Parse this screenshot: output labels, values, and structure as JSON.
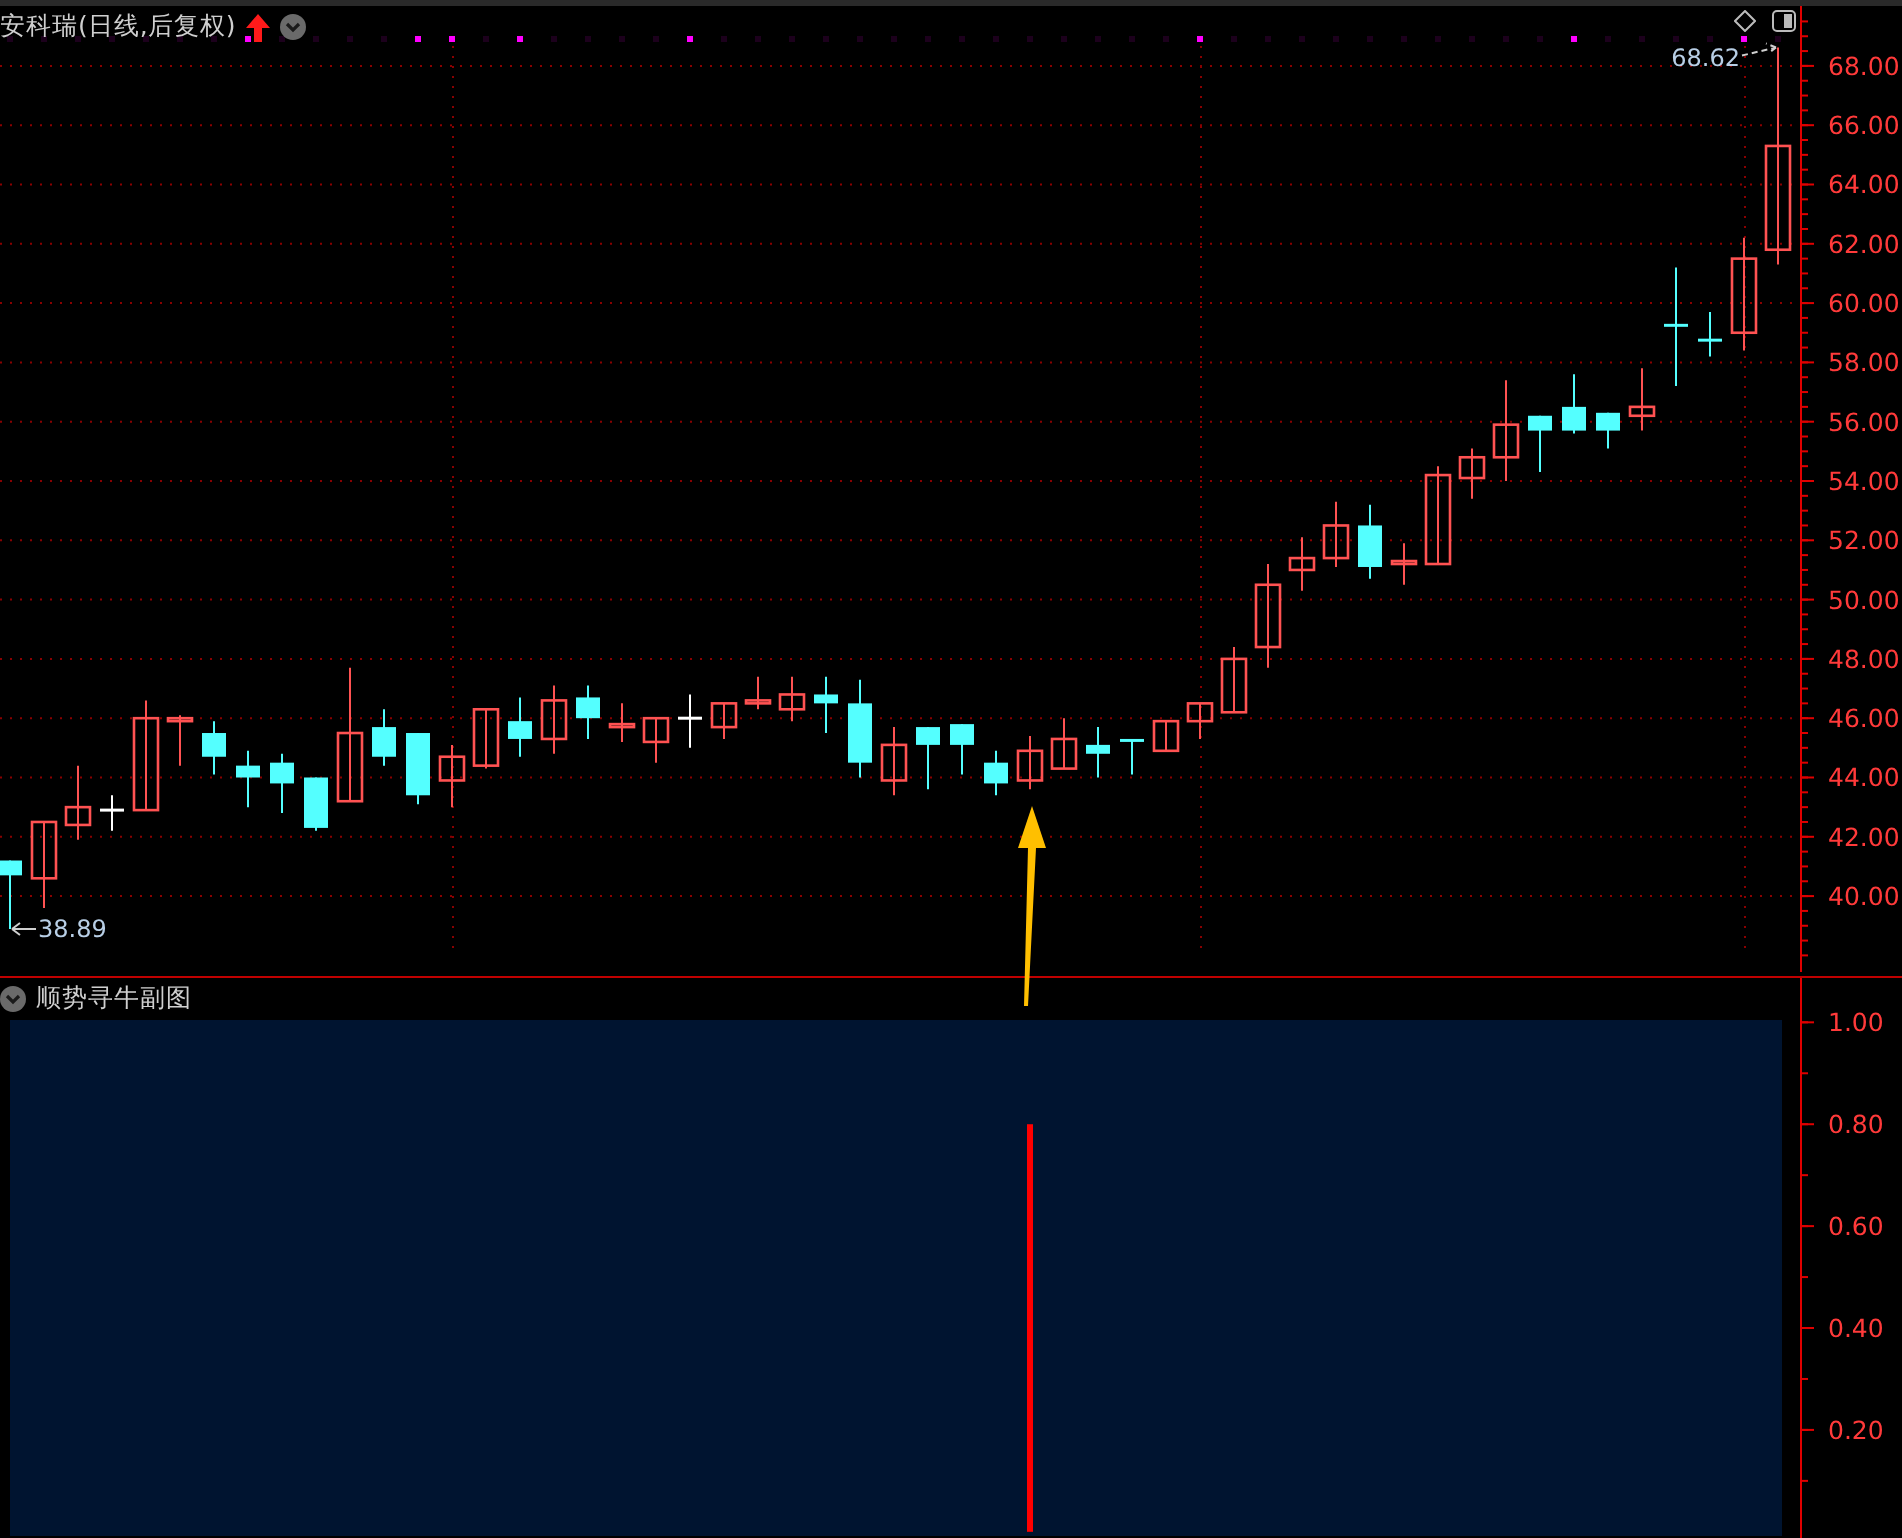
{
  "header": {
    "title": "安科瑞(日线,后复权)"
  },
  "main_chart": {
    "chart_data": {
      "type": "candlestick",
      "ylim": [
        37.44,
        70.02
      ],
      "yticks": [
        {
          "value": 40,
          "label": "40.00"
        },
        {
          "value": 42,
          "label": "42.00"
        },
        {
          "value": 44,
          "label": "44.00"
        },
        {
          "value": 46,
          "label": "46.00"
        },
        {
          "value": 48,
          "label": "48.00"
        },
        {
          "value": 50,
          "label": "50.00"
        },
        {
          "value": 52,
          "label": "52.00"
        },
        {
          "value": 54,
          "label": "54.00"
        },
        {
          "value": 56,
          "label": "56.00"
        },
        {
          "value": 58,
          "label": "58.00"
        },
        {
          "value": 60,
          "label": "60.00"
        },
        {
          "value": 62,
          "label": "62.00"
        },
        {
          "value": 64,
          "label": "64.00"
        },
        {
          "value": 66,
          "label": "66.00"
        },
        {
          "value": 68,
          "label": "68.00"
        }
      ],
      "categories": [
        null,
        null,
        null,
        null,
        null,
        null,
        null,
        null,
        null,
        null,
        null,
        null,
        null,
        null,
        null,
        null,
        null,
        null,
        null,
        null,
        null,
        null,
        null,
        null,
        null,
        null,
        null,
        null,
        null,
        null,
        null,
        null,
        null,
        null,
        null,
        null,
        null,
        null,
        null,
        null,
        null,
        null,
        null,
        null,
        null,
        null,
        null,
        null,
        null,
        null,
        null,
        null,
        null
      ],
      "ohlc": [
        [
          41.2,
          41.2,
          38.89,
          40.7
        ],
        [
          40.6,
          42.5,
          39.6,
          42.5
        ],
        [
          42.4,
          44.4,
          41.9,
          43.0
        ],
        [
          42.9,
          43.4,
          42.2,
          42.9
        ],
        [
          42.9,
          46.6,
          42.9,
          46.0
        ],
        [
          45.9,
          46.1,
          44.4,
          46.0
        ],
        [
          45.5,
          45.9,
          44.1,
          44.7
        ],
        [
          44.4,
          44.9,
          43.0,
          44.0
        ],
        [
          44.5,
          44.8,
          42.8,
          43.8
        ],
        [
          44.0,
          44.0,
          42.2,
          42.3
        ],
        [
          43.2,
          47.7,
          43.2,
          45.5
        ],
        [
          45.7,
          46.3,
          44.4,
          44.7
        ],
        [
          45.5,
          45.5,
          43.1,
          43.4
        ],
        [
          43.9,
          45.1,
          43.0,
          44.7
        ],
        [
          44.4,
          46.3,
          44.3,
          46.3
        ],
        [
          45.9,
          46.7,
          44.7,
          45.3
        ],
        [
          45.3,
          47.1,
          44.8,
          46.6
        ],
        [
          46.7,
          47.1,
          45.3,
          46.0
        ],
        [
          45.7,
          46.5,
          45.2,
          45.8
        ],
        [
          45.2,
          46.0,
          44.5,
          46.0
        ],
        [
          46.0,
          46.8,
          45.0,
          46.0
        ],
        [
          45.7,
          46.5,
          45.3,
          46.5
        ],
        [
          46.5,
          47.4,
          46.3,
          46.6
        ],
        [
          46.3,
          47.4,
          45.9,
          46.8
        ],
        [
          46.8,
          47.4,
          45.5,
          46.5
        ],
        [
          46.5,
          47.3,
          44.0,
          44.5
        ],
        [
          43.9,
          45.7,
          43.4,
          45.1
        ],
        [
          45.7,
          45.7,
          43.6,
          45.1
        ],
        [
          45.8,
          45.8,
          44.1,
          45.1
        ],
        [
          44.5,
          44.9,
          43.4,
          43.8
        ],
        [
          43.9,
          45.4,
          43.6,
          44.9
        ],
        [
          44.3,
          46.0,
          44.3,
          45.3
        ],
        [
          45.1,
          45.7,
          44.0,
          44.8
        ],
        [
          45.3,
          45.3,
          44.1,
          45.2
        ],
        [
          44.9,
          45.9,
          44.9,
          45.9
        ],
        [
          45.9,
          46.5,
          45.3,
          46.5
        ],
        [
          46.2,
          48.4,
          46.2,
          48.0
        ],
        [
          48.4,
          51.2,
          47.7,
          50.5
        ],
        [
          51.0,
          52.1,
          50.3,
          51.4
        ],
        [
          51.4,
          53.3,
          51.1,
          52.5
        ],
        [
          52.5,
          53.2,
          50.7,
          51.1
        ],
        [
          51.2,
          51.9,
          50.5,
          51.3
        ],
        [
          51.2,
          54.5,
          51.2,
          54.2
        ],
        [
          54.1,
          55.1,
          53.4,
          54.8
        ],
        [
          54.8,
          57.4,
          54.0,
          55.9
        ],
        [
          56.2,
          56.2,
          54.3,
          55.7
        ],
        [
          56.5,
          57.6,
          55.6,
          55.7
        ],
        [
          56.3,
          56.3,
          55.1,
          55.7
        ],
        [
          56.2,
          57.8,
          55.7,
          56.5
        ],
        [
          59.3,
          61.2,
          57.2,
          59.2
        ],
        [
          58.8,
          59.7,
          58.2,
          58.7
        ],
        [
          59.0,
          62.2,
          58.4,
          61.5
        ],
        [
          61.8,
          68.62,
          61.3,
          65.3
        ]
      ],
      "annotations": [
        "38.89",
        "68.62"
      ],
      "grid": true
    },
    "signal_dots": [
      false,
      false,
      false,
      false,
      false,
      false,
      false,
      true,
      false,
      false,
      false,
      false,
      true,
      true,
      false,
      true,
      false,
      false,
      false,
      false,
      true,
      false,
      false,
      false,
      false,
      false,
      false,
      false,
      false,
      false,
      false,
      false,
      false,
      false,
      false,
      true,
      false,
      false,
      false,
      false,
      false,
      false,
      false,
      false,
      false,
      false,
      true,
      false,
      false,
      false,
      false,
      true,
      false
    ]
  },
  "sub_chart": {
    "title": "顺势寻牛副图",
    "chart_data": {
      "type": "bar",
      "ylim": [
        -0.02,
        1.087
      ],
      "yticks": [
        {
          "value": 0.2,
          "label": "0.20"
        },
        {
          "value": 0.4,
          "label": "0.40"
        },
        {
          "value": 0.6,
          "label": "0.60"
        },
        {
          "value": 0.8,
          "label": "0.80"
        },
        {
          "value": 1,
          "label": "1.00"
        }
      ],
      "categories": [
        null,
        null,
        null,
        null,
        null,
        null,
        null,
        null,
        null,
        null,
        null,
        null,
        null,
        null,
        null,
        null,
        null,
        null,
        null,
        null,
        null,
        null,
        null,
        null,
        null,
        null,
        null,
        null,
        null,
        null,
        null,
        null,
        null,
        null,
        null,
        null,
        null,
        null,
        null,
        null,
        null,
        null,
        null,
        null,
        null,
        null,
        null,
        null,
        null,
        null,
        null,
        null,
        null
      ],
      "values": [
        null,
        null,
        null,
        null,
        null,
        null,
        null,
        null,
        null,
        null,
        null,
        null,
        null,
        null,
        null,
        null,
        null,
        null,
        null,
        null,
        null,
        null,
        null,
        null,
        null,
        null,
        null,
        null,
        null,
        null,
        0.8,
        null,
        null,
        null,
        null,
        null,
        null,
        null,
        null,
        null,
        null,
        null,
        null,
        null,
        null,
        null,
        null,
        null,
        null,
        null,
        null,
        null,
        null
      ]
    }
  }
}
